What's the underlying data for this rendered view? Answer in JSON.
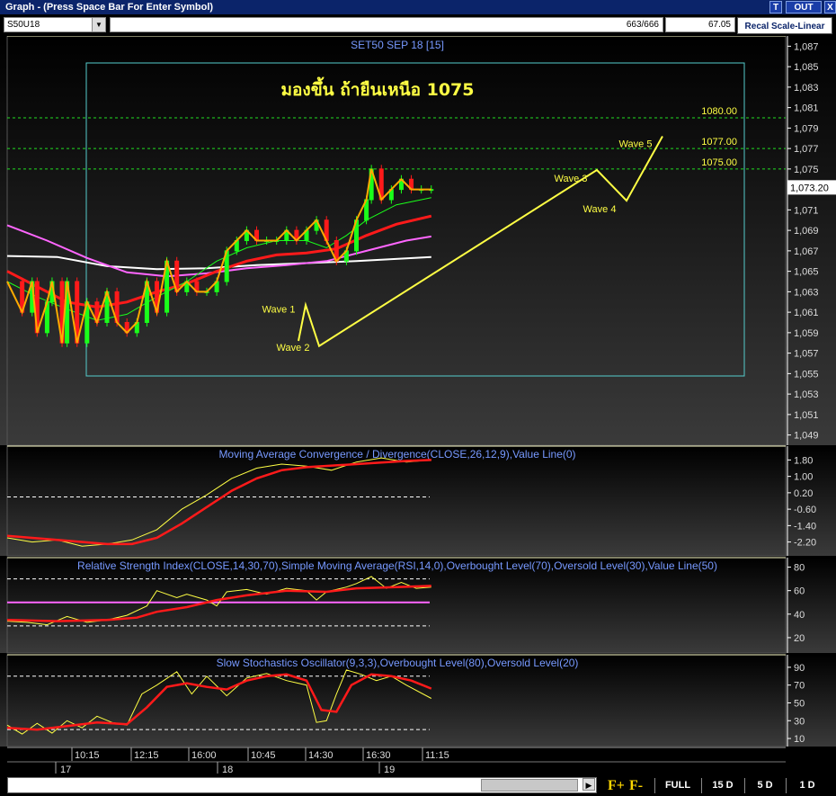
{
  "window": {
    "title": "Graph  - (Press Space Bar For Enter Symbol)",
    "btn_t": "T",
    "btn_out": "OUT",
    "btn_close": "X"
  },
  "toolbar": {
    "symbol": "S50U18",
    "counter": "663/666",
    "value": "67.05",
    "recal_label": "Recal Scale-Linear"
  },
  "colors": {
    "yellow": "#ffff44",
    "red": "#ff1a1a",
    "green": "#1aff1a",
    "pink": "#ff66ff",
    "white": "#ffffff",
    "cyan": "#55cccc",
    "label_blue": "#7799ff",
    "grid_green": "#22dd22"
  },
  "chart_data": [
    {
      "type": "candlestick",
      "title": "SET50 SEP 18   [15]",
      "annotation": "มองขึ้น ถ้ายืนเหนือ 1075",
      "last_price": "1,073.20",
      "ylim": [
        1048,
        1088
      ],
      "yticks": [
        "1,087",
        "1,085",
        "1,083",
        "1,081",
        "1,079",
        "1,077",
        "1,075",
        "1,073",
        "1,071",
        "1,069",
        "1,067",
        "1,065",
        "1,063",
        "1,061",
        "1,059",
        "1,057",
        "1,055",
        "1,053",
        "1,051",
        "1,049"
      ],
      "levels": [
        {
          "label": "1080.00",
          "value": 1080
        },
        {
          "label": "1077.00",
          "value": 1077
        },
        {
          "label": "1075.00",
          "value": 1075
        }
      ],
      "price_path": [
        [
          0,
          1064
        ],
        [
          3,
          1061
        ],
        [
          5,
          1064
        ],
        [
          6,
          1059
        ],
        [
          8,
          1062
        ],
        [
          9,
          1064
        ],
        [
          11,
          1058
        ],
        [
          12,
          1064
        ],
        [
          14,
          1058
        ],
        [
          16,
          1062
        ],
        [
          18,
          1060
        ],
        [
          20,
          1063
        ],
        [
          22,
          1060
        ],
        [
          24,
          1059
        ],
        [
          26,
          1060
        ],
        [
          28,
          1064
        ],
        [
          30,
          1061
        ],
        [
          32,
          1066
        ],
        [
          34,
          1063
        ],
        [
          36,
          1064
        ],
        [
          38,
          1063
        ],
        [
          40,
          1063
        ],
        [
          42,
          1064
        ],
        [
          44,
          1067
        ],
        [
          46,
          1068
        ],
        [
          48,
          1069
        ],
        [
          50,
          1068
        ],
        [
          52,
          1068
        ],
        [
          54,
          1068
        ],
        [
          56,
          1069
        ],
        [
          58,
          1068
        ],
        [
          60,
          1069
        ],
        [
          62,
          1070
        ],
        [
          64,
          1068
        ],
        [
          66,
          1066
        ],
        [
          68,
          1067
        ],
        [
          70,
          1070
        ],
        [
          72,
          1072
        ],
        [
          73,
          1075
        ],
        [
          75,
          1072
        ],
        [
          77,
          1073
        ],
        [
          79,
          1074
        ],
        [
          81,
          1073
        ],
        [
          83,
          1073
        ],
        [
          85,
          1073
        ]
      ],
      "series": [
        {
          "name": "",
          "color": "#ffffff",
          "points": [
            [
              0,
              1066.5
            ],
            [
              10,
              1066.4
            ],
            [
              20,
              1065.5
            ],
            [
              30,
              1065.2
            ],
            [
              40,
              1065.3
            ],
            [
              50,
              1065.6
            ],
            [
              60,
              1065.8
            ],
            [
              70,
              1066
            ],
            [
              85,
              1066.4
            ]
          ]
        },
        {
          "name": "",
          "color": "#ff66ff",
          "points": [
            [
              0,
              1069.5
            ],
            [
              8,
              1068
            ],
            [
              16,
              1066.3
            ],
            [
              24,
              1064.9
            ],
            [
              32,
              1064.5
            ],
            [
              40,
              1064.8
            ],
            [
              48,
              1065.3
            ],
            [
              56,
              1065.6
            ],
            [
              64,
              1066
            ],
            [
              72,
              1067
            ],
            [
              80,
              1068
            ],
            [
              85,
              1068.4
            ]
          ]
        },
        {
          "name": "",
          "color": "#ff1a1a",
          "points": [
            [
              0,
              1065
            ],
            [
              6,
              1063.5
            ],
            [
              12,
              1062
            ],
            [
              18,
              1061.5
            ],
            [
              24,
              1062
            ],
            [
              30,
              1063
            ],
            [
              36,
              1063.8
            ],
            [
              42,
              1065
            ],
            [
              48,
              1066
            ],
            [
              54,
              1066.6
            ],
            [
              60,
              1066.8
            ],
            [
              66,
              1067.2
            ],
            [
              72,
              1068.5
            ],
            [
              78,
              1069.6
            ],
            [
              85,
              1070.4
            ]
          ]
        },
        {
          "name": "",
          "color": "#1aff1a",
          "points": [
            [
              0,
              1064
            ],
            [
              6,
              1062.5
            ],
            [
              12,
              1061.3
            ],
            [
              18,
              1060.2
            ],
            [
              24,
              1060.8
            ],
            [
              30,
              1062.5
            ],
            [
              36,
              1064
            ],
            [
              42,
              1066
            ],
            [
              48,
              1067.3
            ],
            [
              54,
              1068
            ],
            [
              60,
              1068
            ],
            [
              64,
              1067.3
            ],
            [
              68,
              1068.5
            ],
            [
              72,
              1070
            ],
            [
              78,
              1071.5
            ],
            [
              85,
              1072.2
            ]
          ]
        }
      ],
      "waves": {
        "path": [
          [
            1061.5,
            "w0"
          ],
          [
            1058.5,
            "w1"
          ],
          [
            1062,
            "w2"
          ],
          [
            1058,
            "w3"
          ],
          [
            1075,
            "w4"
          ],
          [
            1072,
            "w5"
          ],
          [
            1078,
            "w6"
          ]
        ],
        "labels": [
          {
            "text": "Wave 1",
            "price": 1061.3
          },
          {
            "text": "Wave 2",
            "price": 1057.6
          },
          {
            "text": "Wave 3",
            "price": 1074.1
          },
          {
            "text": "Wave 4",
            "price": 1071.1
          },
          {
            "text": "Wave 5",
            "price": 1077.5
          }
        ]
      },
      "x_axis": {
        "times": [
          "10:15",
          "12:15",
          "16:00",
          "10:45",
          "14:30",
          "16:30",
          "11:15"
        ],
        "days": [
          "17",
          "18",
          "19"
        ]
      }
    },
    {
      "type": "line",
      "title": "Moving Average Convergence / Divergence(CLOSE,26,12,9),Value Line(0)",
      "ylim": [
        -2.7,
        2.3
      ],
      "yticks": [
        "1.80",
        "1.00",
        "0.20",
        "-0.60",
        "-1.40",
        "-2.20"
      ],
      "value_line": 0,
      "series": [
        {
          "name": "",
          "color": "#ffff44",
          "points": [
            [
              0,
              -2.0
            ],
            [
              5,
              -2.2
            ],
            [
              10,
              -2.1
            ],
            [
              15,
              -2.4
            ],
            [
              20,
              -2.3
            ],
            [
              25,
              -2.1
            ],
            [
              30,
              -1.6
            ],
            [
              35,
              -0.6
            ],
            [
              40,
              0.1
            ],
            [
              45,
              0.9
            ],
            [
              50,
              1.4
            ],
            [
              55,
              1.6
            ],
            [
              60,
              1.5
            ],
            [
              65,
              1.3
            ],
            [
              70,
              1.7
            ],
            [
              75,
              1.9
            ],
            [
              80,
              1.7
            ],
            [
              85,
              1.8
            ]
          ]
        },
        {
          "name": "",
          "color": "#ff1a1a",
          "points": [
            [
              0,
              -1.9
            ],
            [
              10,
              -2.1
            ],
            [
              20,
              -2.3
            ],
            [
              25,
              -2.3
            ],
            [
              30,
              -2.0
            ],
            [
              35,
              -1.3
            ],
            [
              40,
              -0.5
            ],
            [
              45,
              0.3
            ],
            [
              50,
              0.9
            ],
            [
              55,
              1.3
            ],
            [
              60,
              1.45
            ],
            [
              70,
              1.6
            ],
            [
              80,
              1.75
            ],
            [
              85,
              1.8
            ]
          ]
        }
      ]
    },
    {
      "type": "line",
      "title": "Relative Strength Index(CLOSE,14,30,70),Simple Moving Average(RSI,14,0),Overbought Level(70),Oversold Level(30),Value Line(50)",
      "ylim": [
        10,
        85
      ],
      "yticks": [
        "80",
        "60",
        "40",
        "20"
      ],
      "levels": [
        70,
        30,
        50
      ],
      "series": [
        {
          "name": "",
          "color": "#ffff44",
          "points": [
            [
              0,
              34
            ],
            [
              4,
              33
            ],
            [
              8,
              31
            ],
            [
              12,
              38
            ],
            [
              16,
              33
            ],
            [
              20,
              35
            ],
            [
              24,
              39
            ],
            [
              28,
              47
            ],
            [
              30,
              60
            ],
            [
              34,
              54
            ],
            [
              36,
              57
            ],
            [
              40,
              52
            ],
            [
              42,
              47
            ],
            [
              44,
              59
            ],
            [
              48,
              61
            ],
            [
              52,
              57
            ],
            [
              56,
              62
            ],
            [
              60,
              60
            ],
            [
              62,
              52
            ],
            [
              64,
              59
            ],
            [
              68,
              63
            ],
            [
              70,
              66
            ],
            [
              73,
              72
            ],
            [
              76,
              62
            ],
            [
              79,
              67
            ],
            [
              82,
              62
            ],
            [
              85,
              63
            ]
          ]
        },
        {
          "name": "",
          "color": "#ff1a1a",
          "points": [
            [
              0,
              35
            ],
            [
              10,
              34
            ],
            [
              20,
              35
            ],
            [
              26,
              37
            ],
            [
              30,
              42
            ],
            [
              36,
              46
            ],
            [
              42,
              52
            ],
            [
              48,
              56
            ],
            [
              56,
              60
            ],
            [
              64,
              59
            ],
            [
              70,
              62
            ],
            [
              78,
              63
            ],
            [
              85,
              64
            ]
          ]
        }
      ]
    },
    {
      "type": "line",
      "title": "Slow Stochastics Oscillator(9,3,3),Overbought Level(80),Oversold Level(20)",
      "ylim": [
        5,
        100
      ],
      "yticks": [
        "90",
        "70",
        "50",
        "30",
        "10"
      ],
      "levels": [
        80,
        20
      ],
      "series": [
        {
          "name": "",
          "color": "#ffff44",
          "points": [
            [
              0,
              25
            ],
            [
              3,
              15
            ],
            [
              6,
              27
            ],
            [
              9,
              16
            ],
            [
              12,
              30
            ],
            [
              15,
              22
            ],
            [
              18,
              35
            ],
            [
              21,
              28
            ],
            [
              24,
              25
            ],
            [
              27,
              60
            ],
            [
              30,
              70
            ],
            [
              34,
              85
            ],
            [
              37,
              60
            ],
            [
              40,
              80
            ],
            [
              44,
              58
            ],
            [
              48,
              78
            ],
            [
              52,
              83
            ],
            [
              56,
              75
            ],
            [
              60,
              70
            ],
            [
              62,
              28
            ],
            [
              64,
              30
            ],
            [
              66,
              60
            ],
            [
              68,
              87
            ],
            [
              71,
              82
            ],
            [
              74,
              75
            ],
            [
              77,
              80
            ],
            [
              80,
              70
            ],
            [
              85,
              55
            ]
          ]
        },
        {
          "name": "",
          "color": "#ff1a1a",
          "points": [
            [
              0,
              22
            ],
            [
              6,
              20
            ],
            [
              12,
              24
            ],
            [
              18,
              28
            ],
            [
              24,
              26
            ],
            [
              28,
              45
            ],
            [
              32,
              68
            ],
            [
              36,
              72
            ],
            [
              40,
              68
            ],
            [
              44,
              65
            ],
            [
              48,
              75
            ],
            [
              52,
              80
            ],
            [
              56,
              82
            ],
            [
              60,
              75
            ],
            [
              63,
              42
            ],
            [
              66,
              40
            ],
            [
              69,
              70
            ],
            [
              73,
              82
            ],
            [
              77,
              80
            ],
            [
              81,
              75
            ],
            [
              85,
              66
            ]
          ]
        }
      ]
    }
  ],
  "bottom": {
    "f_plus": "F+",
    "f_minus": "F-",
    "full": "FULL",
    "p15d": "15 D",
    "p5d": "5 D",
    "p1d": "1 D"
  }
}
